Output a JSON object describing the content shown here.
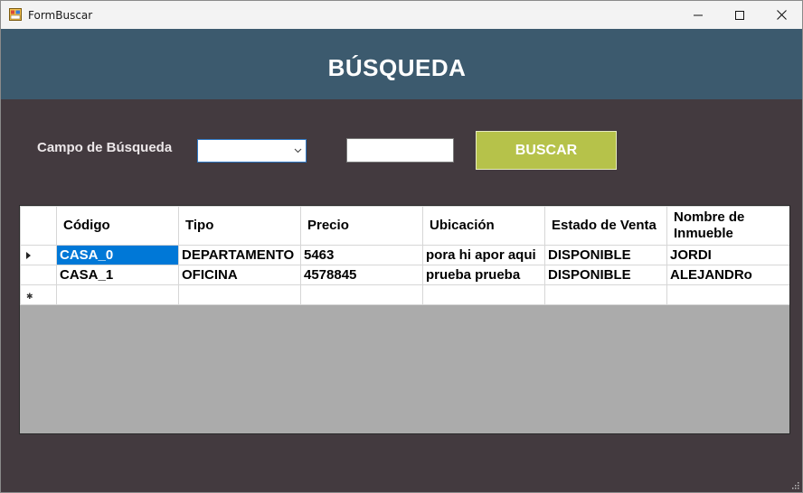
{
  "window": {
    "title": "FormBuscar"
  },
  "header": {
    "title": "BÚSQUEDA"
  },
  "search": {
    "label": "Campo de Búsqueda",
    "combo_value": "",
    "text_value": "",
    "button_label": "BUSCAR"
  },
  "table": {
    "columns": [
      "Código",
      "Tipo",
      "Precio",
      "Ubicación",
      "Estado de Venta",
      "Nombre de Inmueble"
    ],
    "rows": [
      [
        "CASA_0",
        "DEPARTAMENTO",
        "5463",
        "pora hi apor aqui",
        "DISPONIBLE",
        "JORDI"
      ],
      [
        "CASA_1",
        "OFICINA",
        "4578845",
        "prueba prueba",
        "DISPONIBLE",
        "ALEJANDRo"
      ]
    ]
  },
  "colors": {
    "header_bg": "#3c5a6e",
    "window_bg": "#433a3f",
    "button_bg": "#b6c24a",
    "selection": "#0078d7"
  },
  "icons": {
    "app": "app-form-icon",
    "minimize": "minimize-icon",
    "maximize": "maximize-icon",
    "close": "close-icon",
    "dropdown": "chevron-down-icon",
    "current_row": "row-pointer-icon",
    "new_row": "new-row-icon",
    "resize": "resize-grip-icon"
  }
}
